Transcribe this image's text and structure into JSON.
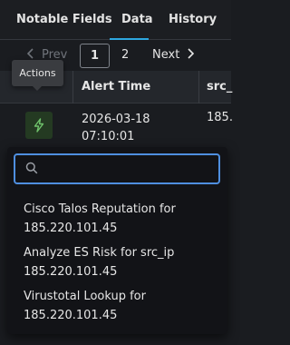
{
  "tabs": [
    {
      "label": "Notable Fields"
    },
    {
      "label": "Data"
    },
    {
      "label": "History"
    }
  ],
  "pager": {
    "prev_label": "Prev",
    "pages": [
      "1",
      "2"
    ],
    "next_label": "Next"
  },
  "table": {
    "headers": [
      "Alert Time",
      "src_"
    ],
    "row": {
      "time_line1": "2026-03-18",
      "time_line2": "07:10:01",
      "ip": "185."
    }
  },
  "tooltip": {
    "label": "Actions"
  },
  "menu": {
    "search_value": "",
    "items": [
      {
        "line1": "Cisco Talos Reputation for",
        "line2": "185.220.101.45"
      },
      {
        "line1": "Analyze ES Risk for src_ip",
        "line2": "185.220.101.45"
      },
      {
        "line1": "Virustotal Lookup for",
        "line2": "185.220.101.45"
      }
    ]
  },
  "colors": {
    "accent": "#2ea7df",
    "focus": "#4f8fe0",
    "action_bg": "#243a22",
    "action_icon": "#6fc26b"
  },
  "icons": {
    "action": "lightning-bolt-icon",
    "search": "search-icon",
    "prev": "chevron-left-icon",
    "next": "chevron-right-icon"
  }
}
